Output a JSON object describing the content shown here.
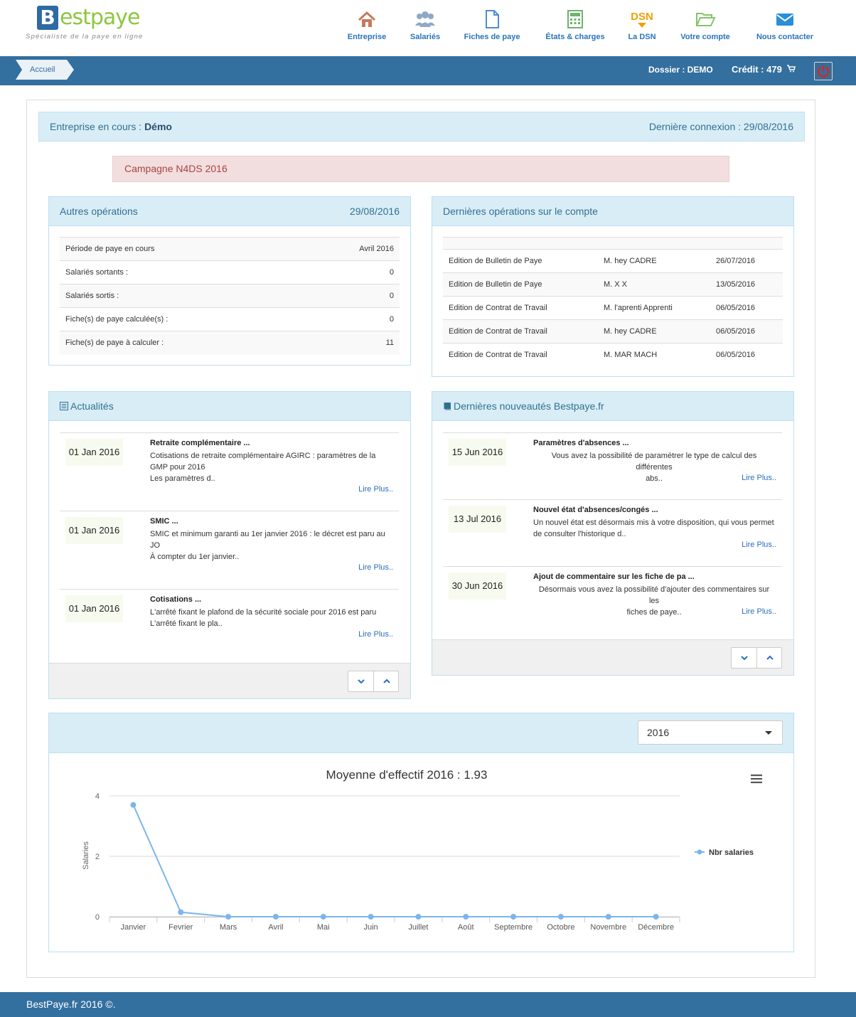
{
  "brand": {
    "letter": "B",
    "name": "estpaye",
    "tagline": "Spécialiste de la paye en ligne"
  },
  "nav": [
    {
      "label": "Entreprise",
      "icon": "home-icon"
    },
    {
      "label": "Salariés",
      "icon": "users-icon"
    },
    {
      "label": "Fiches de paye",
      "icon": "file-icon"
    },
    {
      "label": "États & charges",
      "icon": "calculator-icon"
    },
    {
      "label": "La DSN",
      "icon": "dsn-icon",
      "icon_text": "DSN"
    },
    {
      "label": "Votre compte",
      "icon": "folder-open-icon"
    },
    {
      "label": "Nous contacter",
      "icon": "envelope-icon"
    }
  ],
  "toolbar": {
    "breadcrumb": "Accueil",
    "dossier": "Dossier : DEMO",
    "credit": "Crédit : 479"
  },
  "company": {
    "label": "Entreprise en cours :",
    "name": "Démo",
    "last_login": "Dernière connexion : 29/08/2016"
  },
  "alert": "Campagne N4DS 2016",
  "autres_operations": {
    "title": "Autres opérations",
    "date": "29/08/2016",
    "rows": [
      {
        "label": "Période de paye en cours",
        "value": "Avril 2016"
      },
      {
        "label": "Salariés sortants :",
        "value": "0"
      },
      {
        "label": "Salariés sortis :",
        "value": "0"
      },
      {
        "label": "Fiche(s) de paye calculée(s) :",
        "value": "0"
      },
      {
        "label": "Fiche(s) de paye à calculer :",
        "value": "11"
      }
    ]
  },
  "dernieres_operations": {
    "title": "Dernières opérations sur le compte",
    "rows": [
      {
        "op": "Edition de Bulletin de Paye",
        "who": "M. hey CADRE",
        "date": "26/07/2016"
      },
      {
        "op": "Edition de Bulletin de Paye",
        "who": "M. X X",
        "date": "13/05/2016"
      },
      {
        "op": "Edition de Contrat de Travail",
        "who": "M. l'aprenti Apprenti",
        "date": "06/05/2016"
      },
      {
        "op": "Edition de Contrat de Travail",
        "who": "M. hey CADRE",
        "date": "06/05/2016"
      },
      {
        "op": "Edition de Contrat de Travail",
        "who": "M. MAR MACH",
        "date": "06/05/2016"
      }
    ]
  },
  "actualites": {
    "title": "Actualités",
    "more": "Lire Plus..",
    "items": [
      {
        "date": "01 Jan 2016",
        "title": "Retraite complémentaire ...",
        "lines": [
          "Cotisations de retraite complémentaire AGIRC : paramètres de la",
          "GMP pour 2016",
          "Les paramètres d.."
        ]
      },
      {
        "date": "01 Jan 2016",
        "title": "SMIC ...",
        "lines": [
          "SMIC et minimum garanti au 1er janvier 2016 : le décret est paru au",
          "JO",
          "À compter du 1er janvier.."
        ]
      },
      {
        "date": "01 Jan 2016",
        "title": "Cotisations ...",
        "lines": [
          "L'arrêté fixant le plafond de la sécurité sociale pour 2016 est paru",
          "L'arrêté fixant le pla.."
        ]
      }
    ]
  },
  "nouveautes": {
    "title": "Dernières nouveautés Bestpaye.fr",
    "more": "Lire Plus..",
    "items": [
      {
        "date": "15 Jun 2016",
        "title": "Paramètres d'absences ...",
        "lines": [
          "Vous avez la possibilité de paramétrer le type de calcul des différentes",
          "abs.."
        ]
      },
      {
        "date": "13 Jul 2016",
        "title": "Nouvel état d'absences/congés ...",
        "lines": [
          "Un nouvel état est désormais mis à votre disposition, qui vous permet",
          "de consulter l'historique d.."
        ]
      },
      {
        "date": "30 Jun 2016",
        "title": "Ajout de commentaire sur les fiche de pa ...",
        "lines": [
          "Désormais vous avez la possibilité d'ajouter des commentaires sur les",
          "fiches de paye.."
        ]
      }
    ]
  },
  "year_select": {
    "value": "2016"
  },
  "chart_data": {
    "type": "line",
    "title": "Moyenne d'effectif 2016 : 1.93",
    "ylabel": "Salaries",
    "xlabel": "",
    "categories": [
      "Janvier",
      "Fevrier",
      "Mars",
      "Avril",
      "Mai",
      "Juin",
      "Juillet",
      "Août",
      "Septembre",
      "Octobre",
      "Novembre",
      "Décembre"
    ],
    "series": [
      {
        "name": "Nbr salaries",
        "values": [
          3.7,
          0.15,
          0,
          0,
          0,
          0,
          0,
          0,
          0,
          0,
          0,
          0
        ],
        "color": "#7cb5ec"
      }
    ],
    "ylim": [
      0,
      4
    ],
    "yticks": [
      "0",
      "2",
      "4"
    ],
    "grid": true,
    "legend": "right"
  },
  "footer": "BestPaye.fr 2016 ©.",
  "colors": {
    "bar": "#336f9f",
    "link": "#2a74b9",
    "panel_head": "#d9edf7",
    "alert_bg": "#f2dede",
    "alert_text": "#a94442"
  }
}
